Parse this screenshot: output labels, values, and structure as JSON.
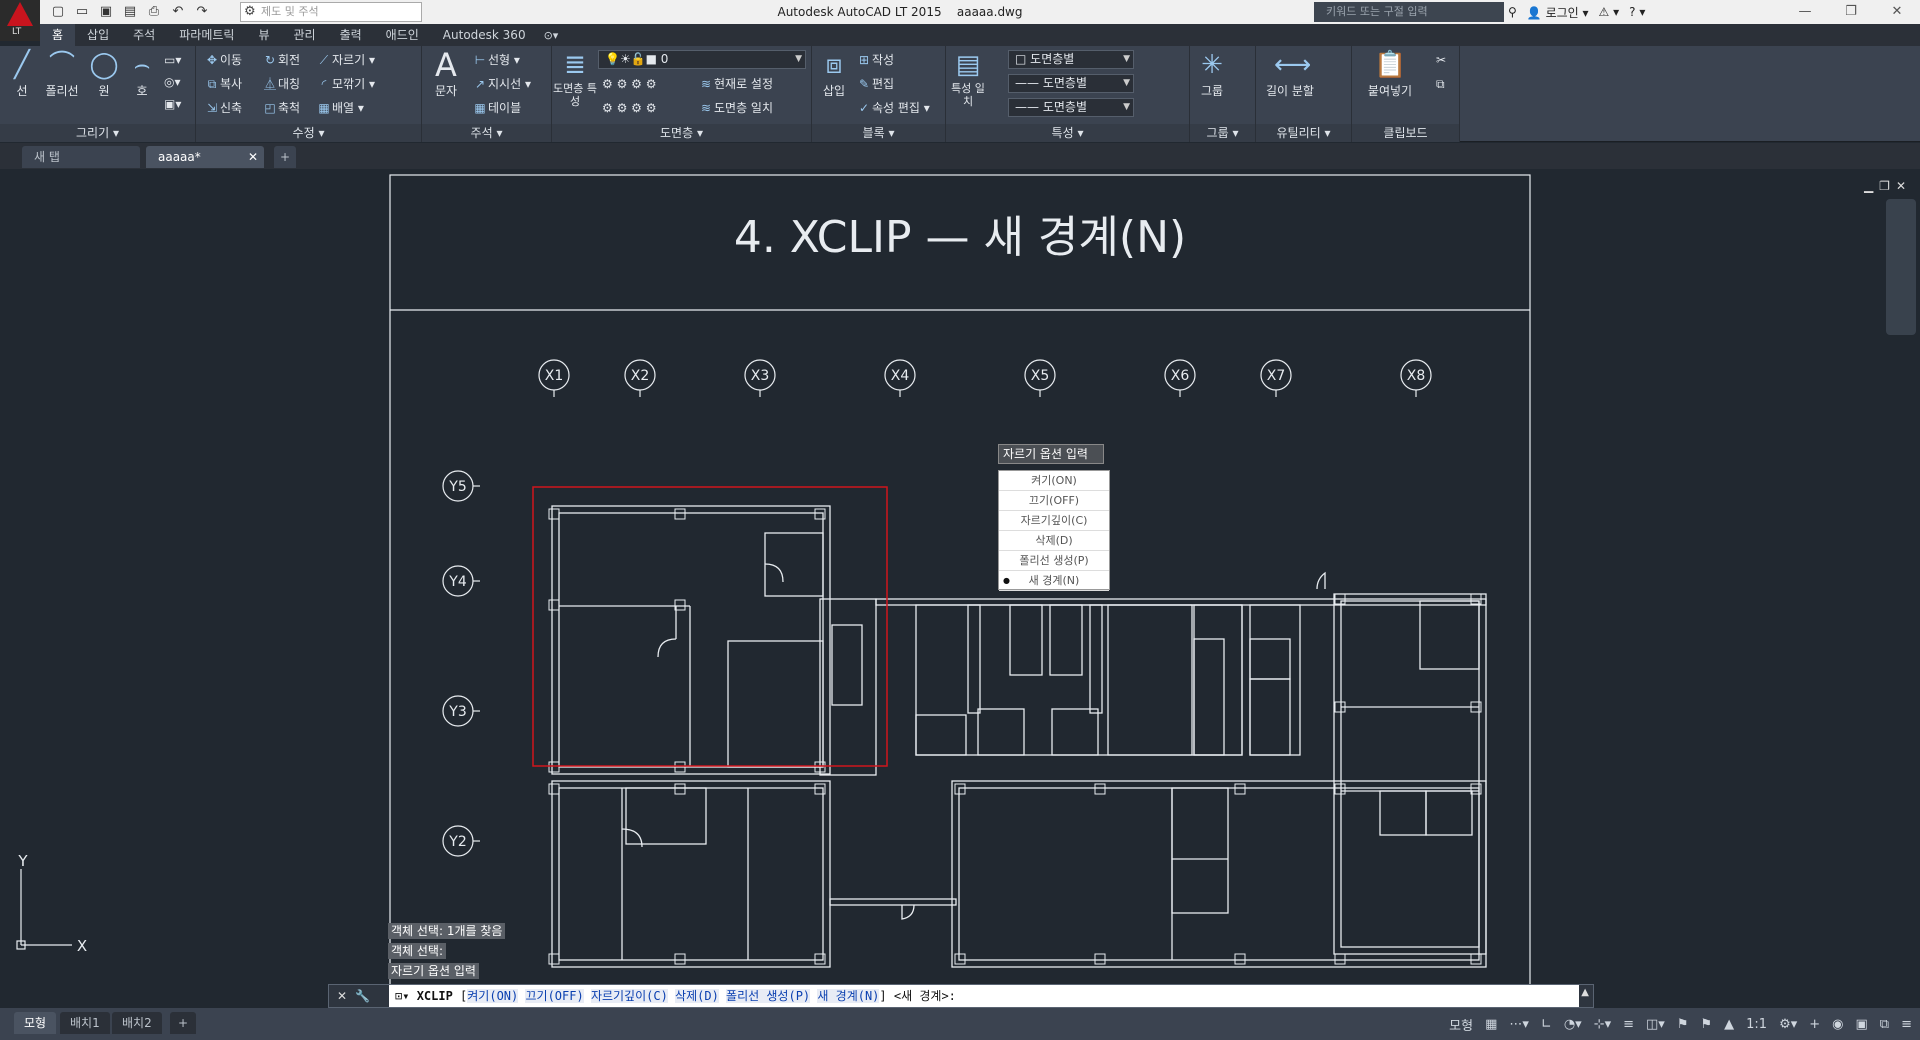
{
  "window": {
    "title": "Autodesk AutoCAD LT 2015",
    "file": "aaaaa.dwg",
    "logo_sub": "LT",
    "workspace": "제도 및 주석",
    "search_placeholder": "키워드 또는 구절 입력",
    "login": "로그인"
  },
  "ribbon_tabs": [
    "홈",
    "삽입",
    "주석",
    "파라메트릭",
    "뷰",
    "관리",
    "출력",
    "애드인",
    "Autodesk 360"
  ],
  "panels": {
    "draw": {
      "title": "그리기",
      "line": "선",
      "polyline": "폴리선",
      "circle": "원",
      "arc": "호"
    },
    "modify": {
      "title": "수정",
      "move": "이동",
      "rotate": "회전",
      "trim": "자르기",
      "copy": "복사",
      "mirror": "대칭",
      "fillet": "모깎기",
      "stretch": "신축",
      "scale": "축척",
      "array": "배열"
    },
    "annotation": {
      "title": "주석",
      "text": "문자",
      "dim": "선형",
      "leader": "지시선",
      "table": "테이블"
    },
    "layers": {
      "title": "도면층",
      "props": "도면층 특성",
      "current_layer": "0",
      "make_current": "현재로 설정",
      "match": "도면층 일치"
    },
    "block": {
      "title": "블록",
      "insert": "삽입",
      "create": "작성",
      "edit": "편집",
      "attr": "속성 편집"
    },
    "properties": {
      "title": "특성",
      "match": "특성 일치",
      "color": "도면층별",
      "linetype": "도면층별",
      "lineweight": "도면층별"
    },
    "groups": {
      "title": "그룹",
      "group": "그룹"
    },
    "utilities": {
      "title": "유틸리티",
      "measure": "길이 분할"
    },
    "clipboard": {
      "title": "클립보드",
      "paste": "붙여넣기"
    }
  },
  "file_tabs": {
    "start": "새 탭",
    "current": "aaaaa*"
  },
  "drawing": {
    "title": "4. XCLIP — 새 경계(N)",
    "grid_x": [
      "X1",
      "X2",
      "X3",
      "X4",
      "X5",
      "X6",
      "X7",
      "X8"
    ],
    "grid_y": [
      "Y5",
      "Y4",
      "Y3",
      "Y2"
    ],
    "ucs_y": "Y",
    "ucs_x": "X"
  },
  "context_menu": {
    "header": "자르기 옵션 입력",
    "items": [
      "켜기(ON)",
      "끄기(OFF)",
      "자르기깊이(C)",
      "삭제(D)",
      "폴리선 생성(P)",
      "새 경계(N)"
    ],
    "selected_index": 5
  },
  "history": [
    "객체 선택: 1개를 찾음",
    "객체 선택:",
    "자르기 옵션 입력"
  ],
  "command": {
    "name": "XCLIP",
    "options": [
      "켜기(ON)",
      "끄기(OFF)",
      "자르기깊이(C)",
      "삭제(D)",
      "폴리선 생성(P)",
      "새 경계(N)"
    ],
    "default": "<새 경계>:"
  },
  "layout_tabs": [
    "모형",
    "배치1",
    "배치2"
  ],
  "status": {
    "model": "모형",
    "scale": "1:1"
  }
}
